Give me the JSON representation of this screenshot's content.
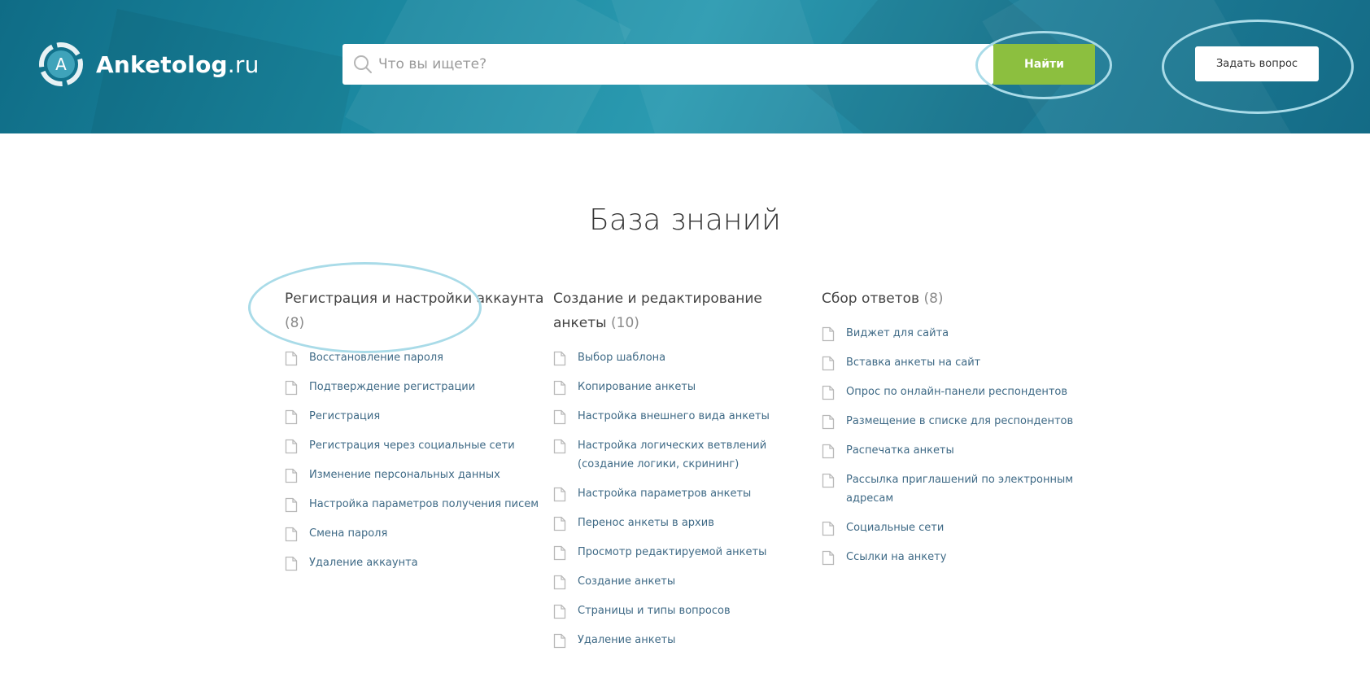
{
  "header": {
    "logo": {
      "name": "Anketolog",
      "tld": ".ru",
      "mark_letter": "A"
    },
    "search": {
      "placeholder": "Что вы ищете?",
      "value": ""
    },
    "find_button_label": "Найти",
    "ask_button_label": "Задать вопрос"
  },
  "colors": {
    "header_bg": "#1c8aa2",
    "find_button": "#8cbf3f",
    "link": "#3f6a86",
    "highlight": "#a9dbe8"
  },
  "main": {
    "title": "База знаний",
    "categories": [
      {
        "title": "Регистрация и настройки аккаунта",
        "count": "(8)",
        "articles": [
          "Восстановление пароля",
          "Подтверждение регистрации",
          "Регистрация",
          "Регистрация через социальные сети",
          "Изменение персональных данных",
          "Настройка параметров получения писем",
          "Смена пароля",
          "Удаление аккаунта"
        ]
      },
      {
        "title": "Создание и редактирование анкеты",
        "count": "(10)",
        "articles": [
          "Выбор шаблона",
          "Копирование анкеты",
          "Настройка внешнего вида анкеты",
          "Настройка логических ветвлений (создание логики, скрининг)",
          "Настройка параметров анкеты",
          "Перенос анкеты в архив",
          "Просмотр редактируемой анкеты",
          "Создание анкеты",
          "Страницы и типы вопросов",
          "Удаление анкеты"
        ]
      },
      {
        "title": "Сбор ответов",
        "count": "(8)",
        "articles": [
          "Виджет для сайта",
          "Вставка анкеты на сайт",
          "Опрос по онлайн-панели респондентов",
          "Размещение в списке для респондентов",
          "Распечатка анкеты",
          "Рассылка приглашений по электронным адресам",
          "Социальные сети",
          "Ссылки на анкету"
        ]
      }
    ]
  }
}
